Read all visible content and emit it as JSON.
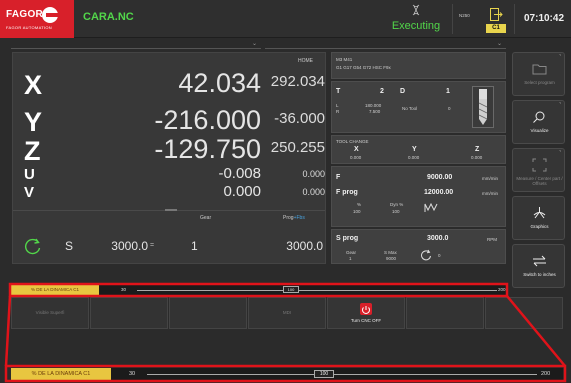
{
  "header": {
    "brand": "FAGOR",
    "brand_sub": "FAGOR AUTOMATION",
    "program_name": "CARA.NC",
    "status": "Executing",
    "n_label": "N250",
    "channel": "C1",
    "clock": "07:10:42",
    "status_color": "#52d64a"
  },
  "axes": {
    "home_label": "HOME",
    "rows": [
      {
        "axis": "X",
        "value": "42.034",
        "secondary": "292.034"
      },
      {
        "axis": "Y",
        "value": "-216.000",
        "secondary": "-36.000"
      },
      {
        "axis": "Z",
        "value": "-129.750",
        "secondary": "250.255"
      },
      {
        "axis": "U",
        "value": "-0.008",
        "secondary": "0.000"
      },
      {
        "axis": "V",
        "value": "0.000",
        "secondary": "0.000"
      }
    ],
    "gear_header": "Gear",
    "prog_header": "Prog",
    "prog_header_plus": "+Fbs",
    "spindle_letter": "S",
    "spindle_value": "3000.0",
    "spindle_unit": "=",
    "gear_value": "1",
    "prog_value": "3000.0"
  },
  "info": {
    "codes_line1": "M3 M41",
    "codes_line2": "G1 G17 G54 G72 HSC F9x",
    "tool": {
      "t_label": "T",
      "t_value": "2",
      "d_label": "D",
      "d_value": "1",
      "l_label": "L",
      "l_value": "180.000",
      "r_label": "R",
      "r_value": "7.500",
      "name": "No Tool",
      "count": "0"
    },
    "tool_change": {
      "title": "TOOL CHANGE",
      "x_label": "X",
      "x_value": "0.000",
      "y_label": "Y",
      "y_value": "0.000",
      "z_label": "Z",
      "z_value": "0.000"
    },
    "feed": {
      "f_label": "F",
      "f_value": "9000.00",
      "f_unit": "mm/min",
      "fprog_label": "F prog",
      "fprog_value": "12000.00",
      "fprog_unit": "mm/min",
      "pct_label": "%",
      "pct_value": "100",
      "dyn_label": "Dyn %",
      "dyn_value": "100"
    },
    "spindle": {
      "sprog_label": "S prog",
      "sprog_value": "3000.0",
      "sprog_unit": "RPM",
      "gear_label": "Gear",
      "gear_value": "1",
      "smax_label": "S Max",
      "smax_value": "9000",
      "rot_value": "0"
    }
  },
  "softkeys_right": [
    {
      "label": "Select program",
      "icon": "folder-icon",
      "dim": true
    },
    {
      "label": "Visualize",
      "icon": "magnifier-icon",
      "dim": false
    },
    {
      "label": "Measure / Center part / Offsets",
      "icon": "measure-icon",
      "dim": true
    },
    {
      "label": "Graphics",
      "icon": "graphics-icon",
      "dim": false
    },
    {
      "label": "Switch to inches",
      "icon": "switch-icon",
      "dim": false
    }
  ],
  "feed_strip": {
    "label": "% DE LA DINAMICA C1",
    "min": "30",
    "current": "100",
    "max": "200",
    "override_percent": 100,
    "accent": "#e8c640"
  },
  "softkeys_bottom": [
    {
      "label": "Visible Superfi",
      "active": false
    },
    {
      "label": "",
      "active": false
    },
    {
      "label": "",
      "active": false
    },
    {
      "label": "MDI",
      "active": false
    },
    {
      "label": "Turn CNC OFF",
      "active": true
    },
    {
      "label": "",
      "active": false
    },
    {
      "label": "",
      "active": false
    }
  ],
  "colors": {
    "brand_red": "#d8202a",
    "highlight_red": "#e0131a"
  }
}
